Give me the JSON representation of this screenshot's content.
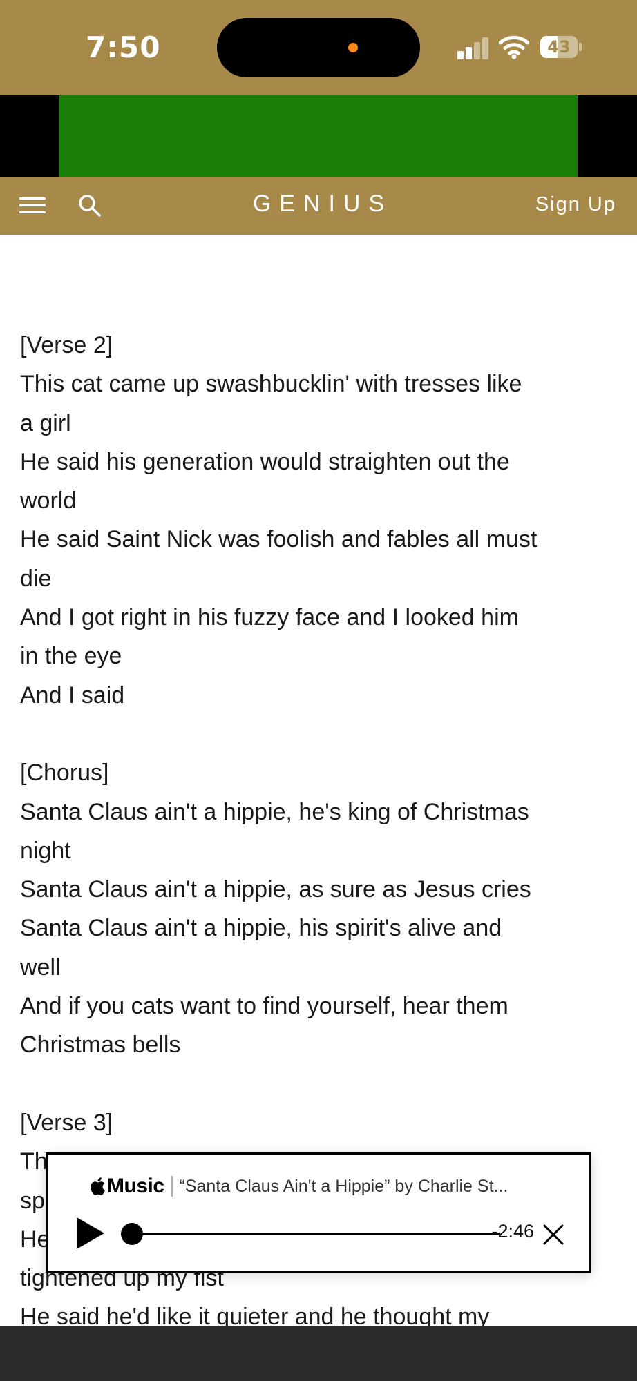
{
  "status_bar": {
    "time": "7:50",
    "battery": "43",
    "icons": [
      "signal-icon",
      "wifi-icon",
      "battery-icon"
    ]
  },
  "nav": {
    "logo": "GENIUS",
    "signup": "Sign Up",
    "icons": [
      "menu-icon",
      "search-icon"
    ]
  },
  "lyrics": [
    "[Verse 2]",
    "This cat came up swashbucklin' with tresses like",
    "a girl",
    "He said his generation would straighten out the",
    "world",
    "He said Saint Nick was foolish and fables all must",
    "die",
    "And I got right in his fuzzy face and I looked him",
    "in the eye",
    "And I said",
    "",
    "[Chorus]",
    "Santa Claus ain't a hippie, he's king of Christmas",
    "night",
    "Santa Claus ain't a hippie, as sure as Jesus cries",
    "Santa Claus ain't a hippie, his spirit's alive and",
    "well",
    "And if you cats want to find yourself, hear them",
    "Christmas bells",
    "",
    "[Verse 3]",
    "Th",
    "sp",
    "He",
    "tightened up my fist",
    "He said he'd like it quieter and he thought my"
  ],
  "player": {
    "brand": "Music",
    "track": "“Santa Claus Ain't a Hippie” by Charlie St...",
    "time_remaining": "-2:46",
    "progress": 0,
    "icons": [
      "apple-icon",
      "play-icon",
      "close-icon"
    ]
  },
  "colors": {
    "brand_gold": "#a78a49",
    "ad_green": "#1a7f08",
    "bottom_bar": "#2b2b2b"
  }
}
